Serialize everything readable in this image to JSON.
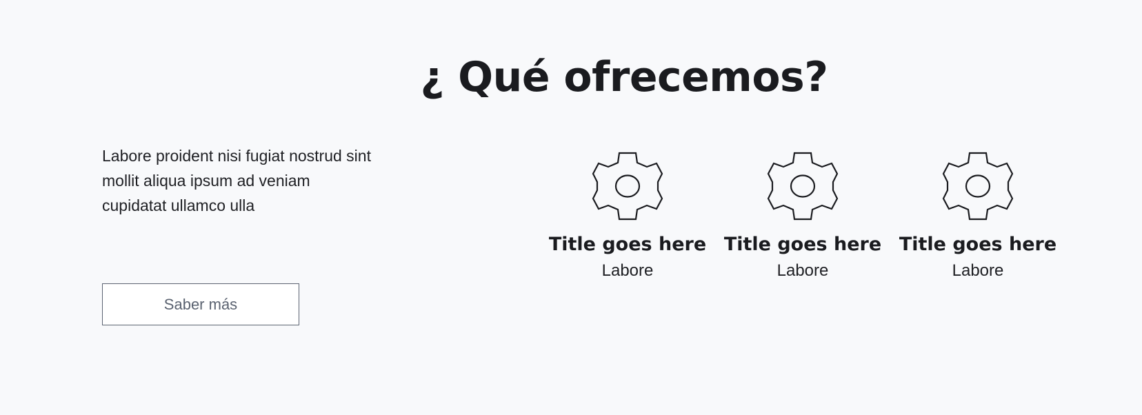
{
  "section": {
    "title": "¿ Qué ofrecemos?",
    "description": "Labore proident nisi fugiat nostrud sint mollit aliqua ipsum ad veniam cupidatat ullamco ulla",
    "cta_label": "Saber más"
  },
  "features": [
    {
      "icon": "gear-icon",
      "title": "Title goes here",
      "text": "Labore"
    },
    {
      "icon": "gear-icon",
      "title": "Title goes here",
      "text": "Labore"
    },
    {
      "icon": "gear-icon",
      "title": "Title goes here",
      "text": "Labore"
    }
  ],
  "colors": {
    "background": "#f8f9fb",
    "text": "#1a1b1f",
    "button_border": "#5a6270",
    "button_text": "#5a6270"
  }
}
